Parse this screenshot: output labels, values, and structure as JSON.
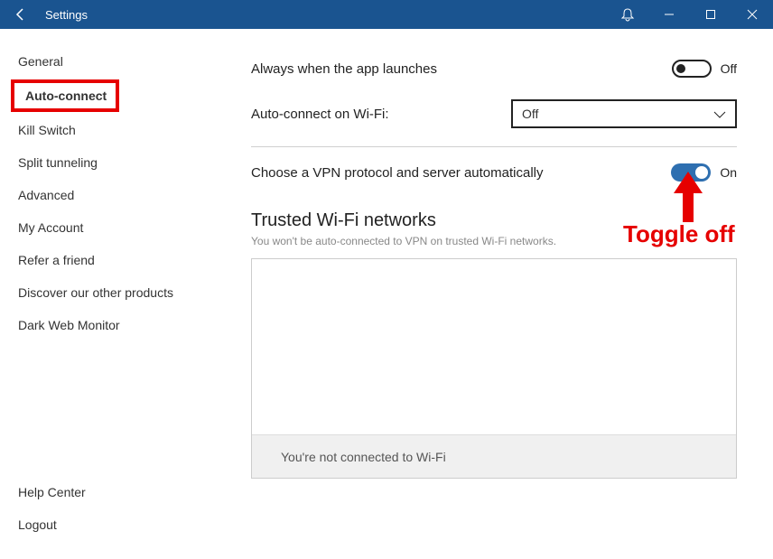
{
  "titlebar": {
    "title": "Settings"
  },
  "sidebar": {
    "items": [
      {
        "label": "General"
      },
      {
        "label": "Auto-connect"
      },
      {
        "label": "Kill Switch"
      },
      {
        "label": "Split tunneling"
      },
      {
        "label": "Advanced"
      },
      {
        "label": "My Account"
      },
      {
        "label": "Refer a friend"
      },
      {
        "label": "Discover our other products"
      },
      {
        "label": "Dark Web Monitor"
      }
    ],
    "bottom": [
      {
        "label": "Help Center"
      },
      {
        "label": "Logout"
      }
    ]
  },
  "main": {
    "always_launch": {
      "label": "Always when the app launches",
      "state": "Off"
    },
    "autoconnect_wifi": {
      "label": "Auto-connect on Wi-Fi:",
      "value": "Off"
    },
    "choose_protocol": {
      "label": "Choose a VPN protocol and server automatically",
      "state": "On"
    },
    "trusted": {
      "title": "Trusted Wi-Fi networks",
      "sub": "You won't be auto-connected to VPN on trusted Wi-Fi networks.",
      "footer": "You're not connected to Wi-Fi"
    }
  },
  "annotation": {
    "text": "Toggle off"
  }
}
